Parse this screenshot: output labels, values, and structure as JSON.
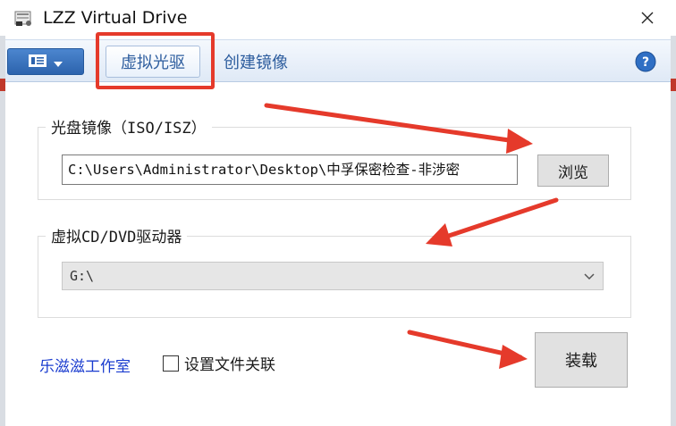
{
  "window": {
    "title": "LZZ Virtual Drive"
  },
  "toolbar": {
    "tabs": [
      {
        "label": "虚拟光驱",
        "active": true
      },
      {
        "label": "创建镜像",
        "active": false
      }
    ]
  },
  "iso_group": {
    "legend": "光盘镜像（ISO/ISZ）",
    "path_value": "C:\\Users\\Administrator\\Desktop\\中孚保密检查-非涉密",
    "browse_label": "浏览"
  },
  "drive_group": {
    "legend": "虚拟CD/DVD驱动器",
    "selected": "G:\\"
  },
  "footer": {
    "studio_link": "乐滋滋工作室",
    "file_assoc_label": "设置文件关联",
    "file_assoc_checked": false,
    "mount_label": "装载"
  },
  "colors": {
    "annotation": "#e53a2b",
    "accent": "#2d5d9e",
    "link": "#1a3ccf"
  },
  "icons": [
    "app-icon",
    "close-icon",
    "menu-icon",
    "help-icon",
    "chevron-down-icon"
  ]
}
